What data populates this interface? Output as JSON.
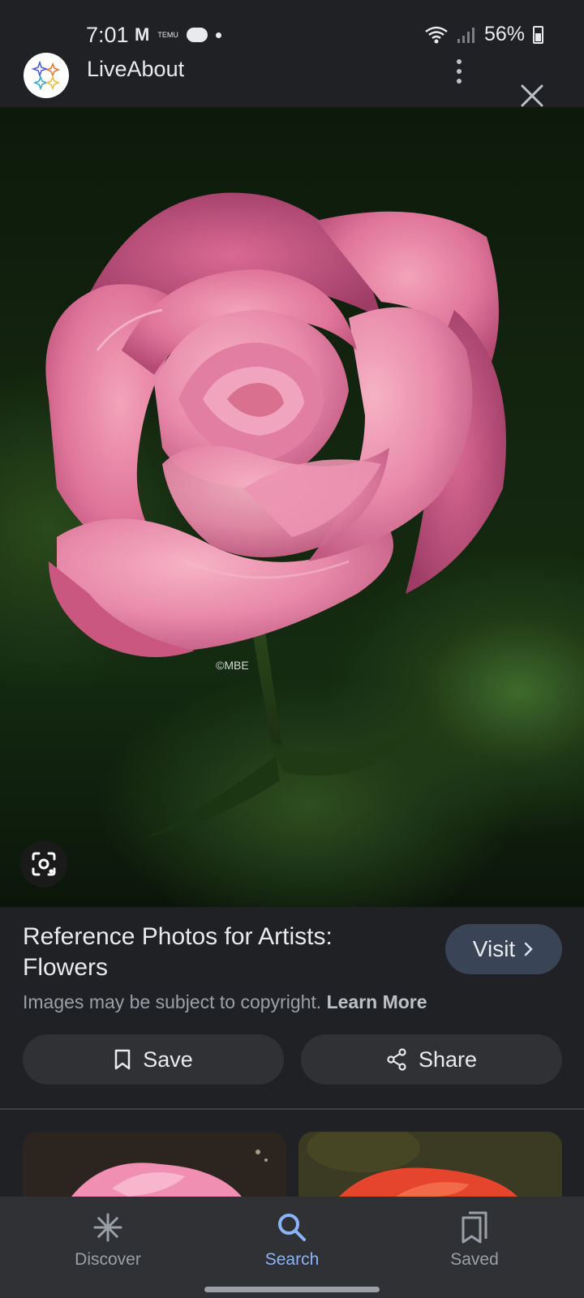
{
  "status_bar": {
    "time": "7:01",
    "temu_label": "TEMU",
    "battery": "56%",
    "icons": [
      "gmail-icon",
      "temu-icon",
      "cloud-icon",
      "dot-icon",
      "wifi-icon",
      "signal-icon",
      "battery-icon"
    ]
  },
  "header": {
    "site_name": "LiveAbout",
    "icons": [
      "sparkle-logo-icon",
      "more-vert-icon",
      "close-icon"
    ]
  },
  "image": {
    "watermark": "©MBE",
    "lens_icon": "lens-icon"
  },
  "result": {
    "title": "Reference Photos for Artists: Flowers",
    "visit_label": "Visit",
    "copyright_text": "Images may be subject to copyright.",
    "learn_more": "Learn More"
  },
  "actions": {
    "save_label": "Save",
    "share_label": "Share"
  },
  "bottom_nav": {
    "items": [
      {
        "label": "Discover",
        "icon": "asterisk-icon",
        "active": false
      },
      {
        "label": "Search",
        "icon": "search-icon",
        "active": true
      },
      {
        "label": "Saved",
        "icon": "saved-icon",
        "active": false
      }
    ]
  },
  "colors": {
    "background": "#202124",
    "accent": "#8ab4f8",
    "visit_button": "#394457",
    "rose": "#e26f98"
  }
}
